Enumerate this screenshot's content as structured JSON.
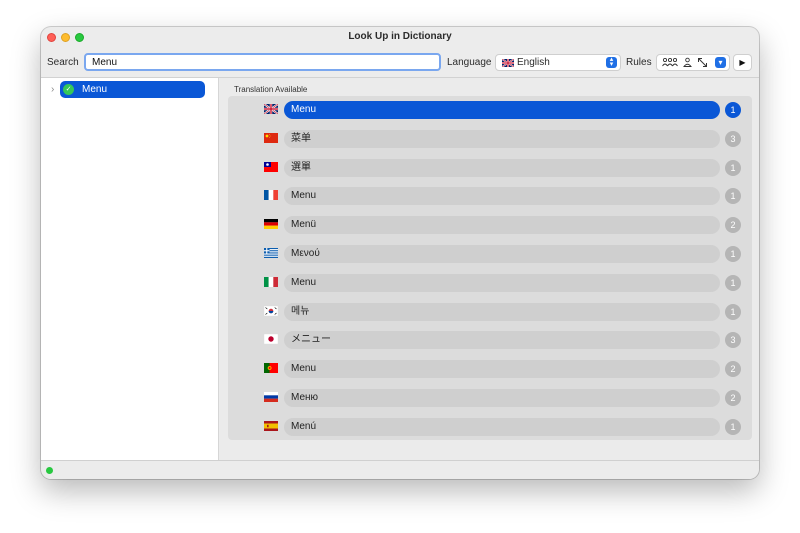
{
  "window": {
    "title": "Look Up in Dictionary"
  },
  "toolbar": {
    "search_label": "Search",
    "search_value": "Menu",
    "language_label": "Language",
    "language_value": "English",
    "language_flag": "gb",
    "rules_label": "Rules",
    "rules_icons": [
      "group-icon",
      "person-icon",
      "resize-icon",
      "chevron-down-icon"
    ],
    "play_icon": "play-icon"
  },
  "sidebar": {
    "items": [
      {
        "label": "Menu",
        "status_icon": "check-circle-icon",
        "selected": true
      }
    ]
  },
  "main": {
    "section_header": "Translation Available",
    "translations": [
      {
        "flag": "gb",
        "text": "Menu",
        "count": "1",
        "selected": true
      },
      {
        "flag": "cn",
        "text": "菜单",
        "count": "3",
        "selected": false
      },
      {
        "flag": "tw",
        "text": "選單",
        "count": "1",
        "selected": false
      },
      {
        "flag": "fr",
        "text": "Menu",
        "count": "1",
        "selected": false
      },
      {
        "flag": "de",
        "text": "Menü",
        "count": "2",
        "selected": false
      },
      {
        "flag": "gr",
        "text": "Μενού",
        "count": "1",
        "selected": false
      },
      {
        "flag": "it",
        "text": "Menu",
        "count": "1",
        "selected": false
      },
      {
        "flag": "kr",
        "text": "메뉴",
        "count": "1",
        "selected": false
      },
      {
        "flag": "jp",
        "text": "メニュー",
        "count": "3",
        "selected": false
      },
      {
        "flag": "pt",
        "text": "Menu",
        "count": "2",
        "selected": false
      },
      {
        "flag": "ru",
        "text": "Меню",
        "count": "2",
        "selected": false
      },
      {
        "flag": "es",
        "text": "Menú",
        "count": "1",
        "selected": false
      }
    ]
  },
  "colors": {
    "accent": "#0a57d6",
    "badge": "#b5b5b5",
    "status_ok": "#28c840"
  }
}
